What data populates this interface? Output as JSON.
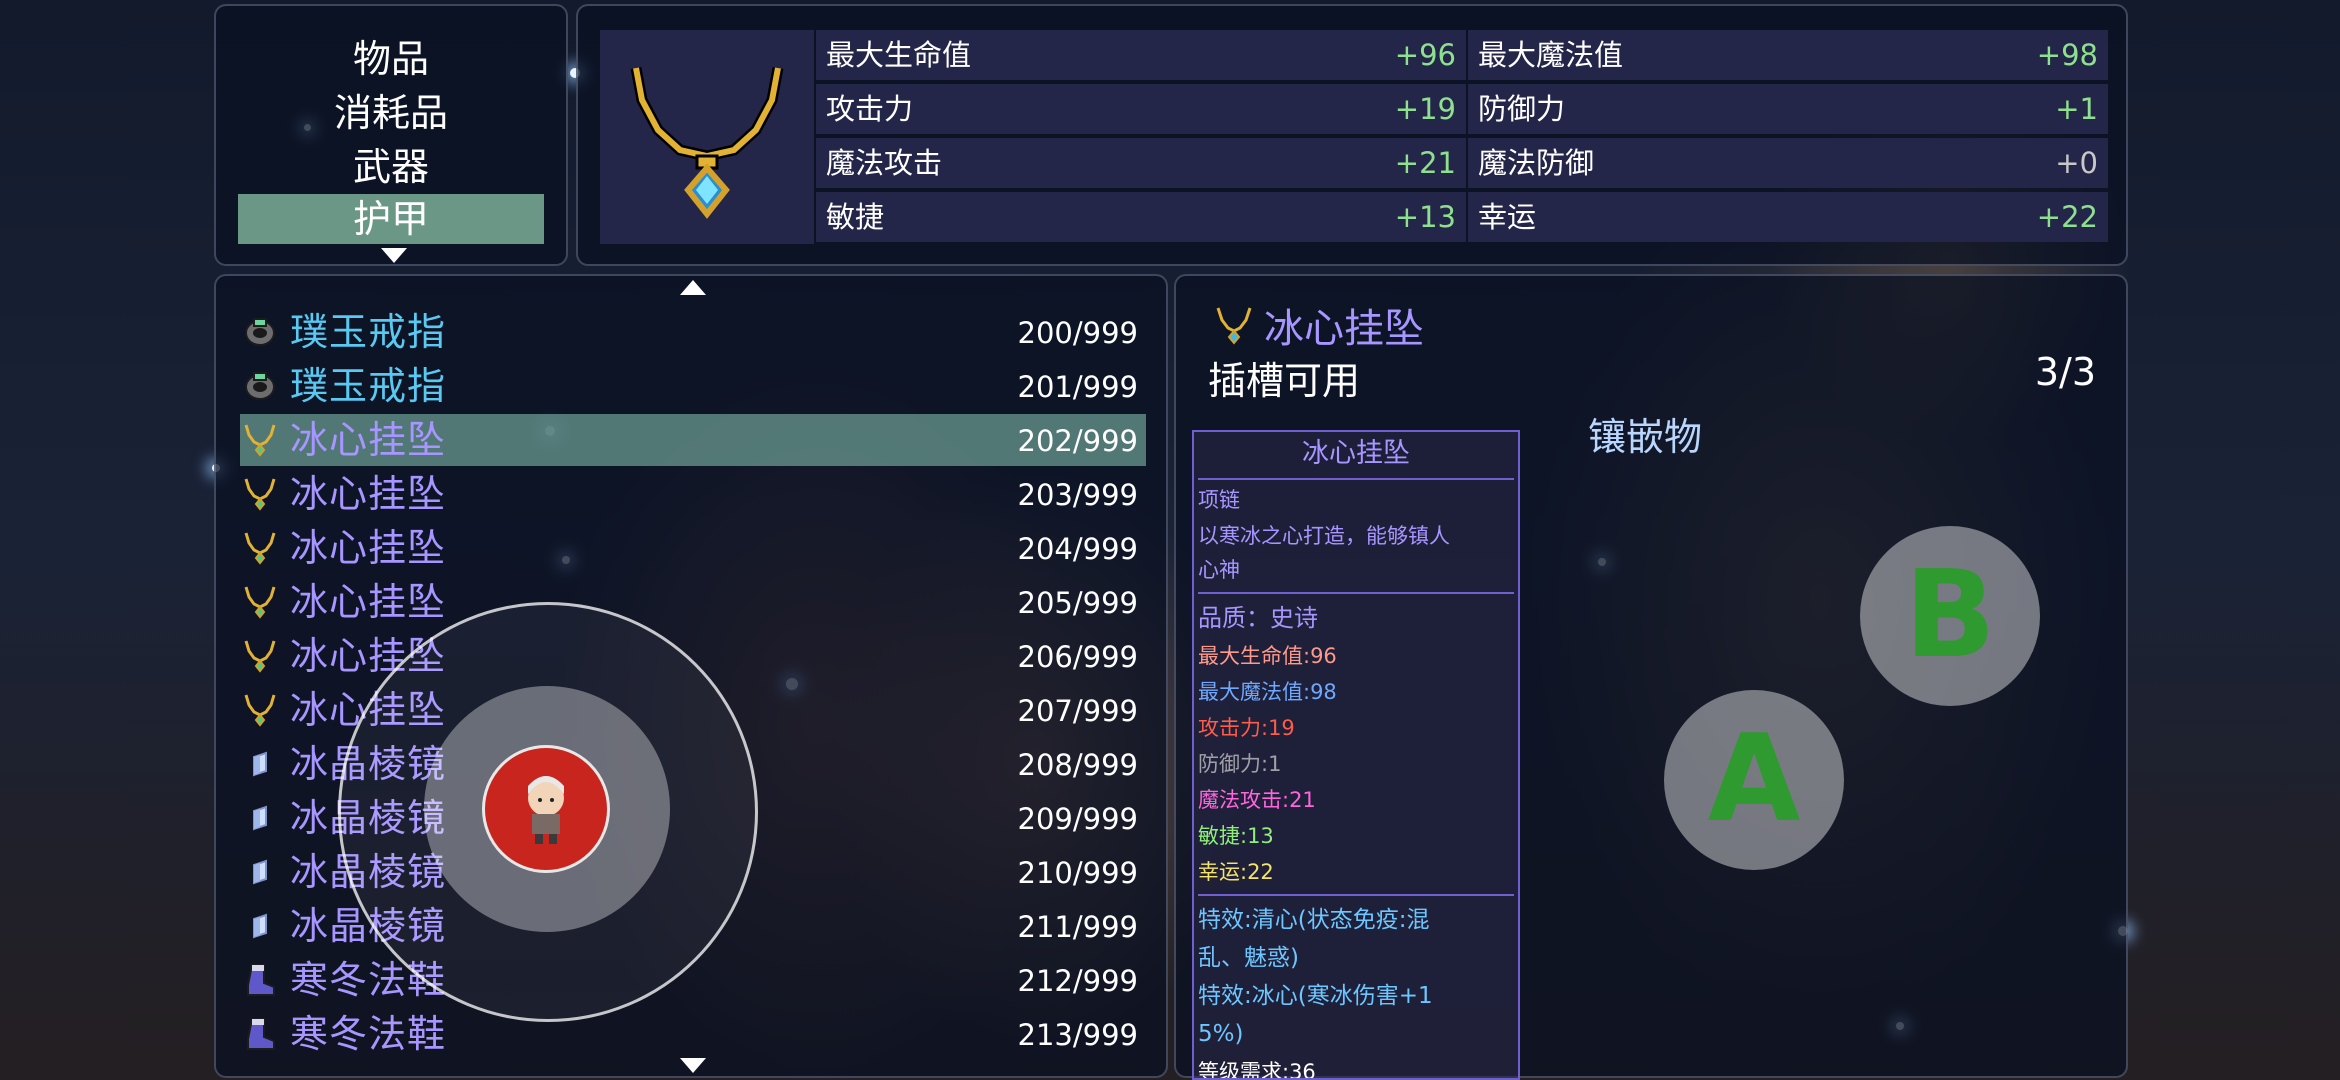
{
  "categories": {
    "items": [
      "物品",
      "消耗品",
      "武器",
      "护甲"
    ],
    "selected_index": 3
  },
  "stats": {
    "rows": [
      {
        "label": "最大生命值",
        "value": "+96"
      },
      {
        "label": "最大魔法值",
        "value": "+98"
      },
      {
        "label": "攻击力",
        "value": "+19"
      },
      {
        "label": "防御力",
        "value": "+1"
      },
      {
        "label": "魔法攻击",
        "value": "+21"
      },
      {
        "label": "魔法防御",
        "value": "+0"
      },
      {
        "label": "敏捷",
        "value": "+13"
      },
      {
        "label": "幸运",
        "value": "+22"
      }
    ]
  },
  "item_list": {
    "selected_index": 2,
    "items": [
      {
        "name": "璞玉戒指",
        "count": "200/999",
        "icon": "ring-icon"
      },
      {
        "name": "璞玉戒指",
        "count": "201/999",
        "icon": "ring-icon"
      },
      {
        "name": "冰心挂坠",
        "count": "202/999",
        "icon": "necklace-icon"
      },
      {
        "name": "冰心挂坠",
        "count": "203/999",
        "icon": "necklace-icon"
      },
      {
        "name": "冰心挂坠",
        "count": "204/999",
        "icon": "necklace-icon"
      },
      {
        "name": "冰心挂坠",
        "count": "205/999",
        "icon": "necklace-icon"
      },
      {
        "name": "冰心挂坠",
        "count": "206/999",
        "icon": "necklace-icon"
      },
      {
        "name": "冰心挂坠",
        "count": "207/999",
        "icon": "necklace-icon"
      },
      {
        "name": "冰晶棱镜",
        "count": "208/999",
        "icon": "prism-icon"
      },
      {
        "name": "冰晶棱镜",
        "count": "209/999",
        "icon": "prism-icon"
      },
      {
        "name": "冰晶棱镜",
        "count": "210/999",
        "icon": "prism-icon"
      },
      {
        "name": "冰晶棱镜",
        "count": "211/999",
        "icon": "prism-icon"
      },
      {
        "name": "寒冬法鞋",
        "count": "212/999",
        "icon": "boot-icon"
      },
      {
        "name": "寒冬法鞋",
        "count": "213/999",
        "icon": "boot-icon"
      }
    ]
  },
  "detail": {
    "title": "冰心挂坠",
    "slot_label": "插槽可用",
    "slot_count": "3/3",
    "inlay_label": "镶嵌物",
    "card": {
      "title": "冰心挂坠",
      "type": "项链",
      "desc_1": "以寒冰之心打造，能够镇人",
      "desc_2": "心神",
      "quality": "品质：史诗",
      "hp": "最大生命值:96",
      "mp": "最大魔法值:98",
      "atk": "攻击力:19",
      "def": "防御力:1",
      "matk": "魔法攻击:21",
      "agi": "敏捷:13",
      "luck": "幸运:22",
      "effect1_a": "特效:清心(状态免疫:混",
      "effect1_b": "乱、魅惑)",
      "effect2_a": "特效:冰心(寒冰伤害+1",
      "effect2_b": "5%)",
      "level_req": "等级需求:36"
    }
  },
  "controls": {
    "button_a": "A",
    "button_b": "B"
  },
  "colors": {
    "item_name_blue": "#59c9f2",
    "item_name_purple": "#a796ff",
    "stat_value_green": "#8ee08e",
    "selection": "#6b9886"
  }
}
